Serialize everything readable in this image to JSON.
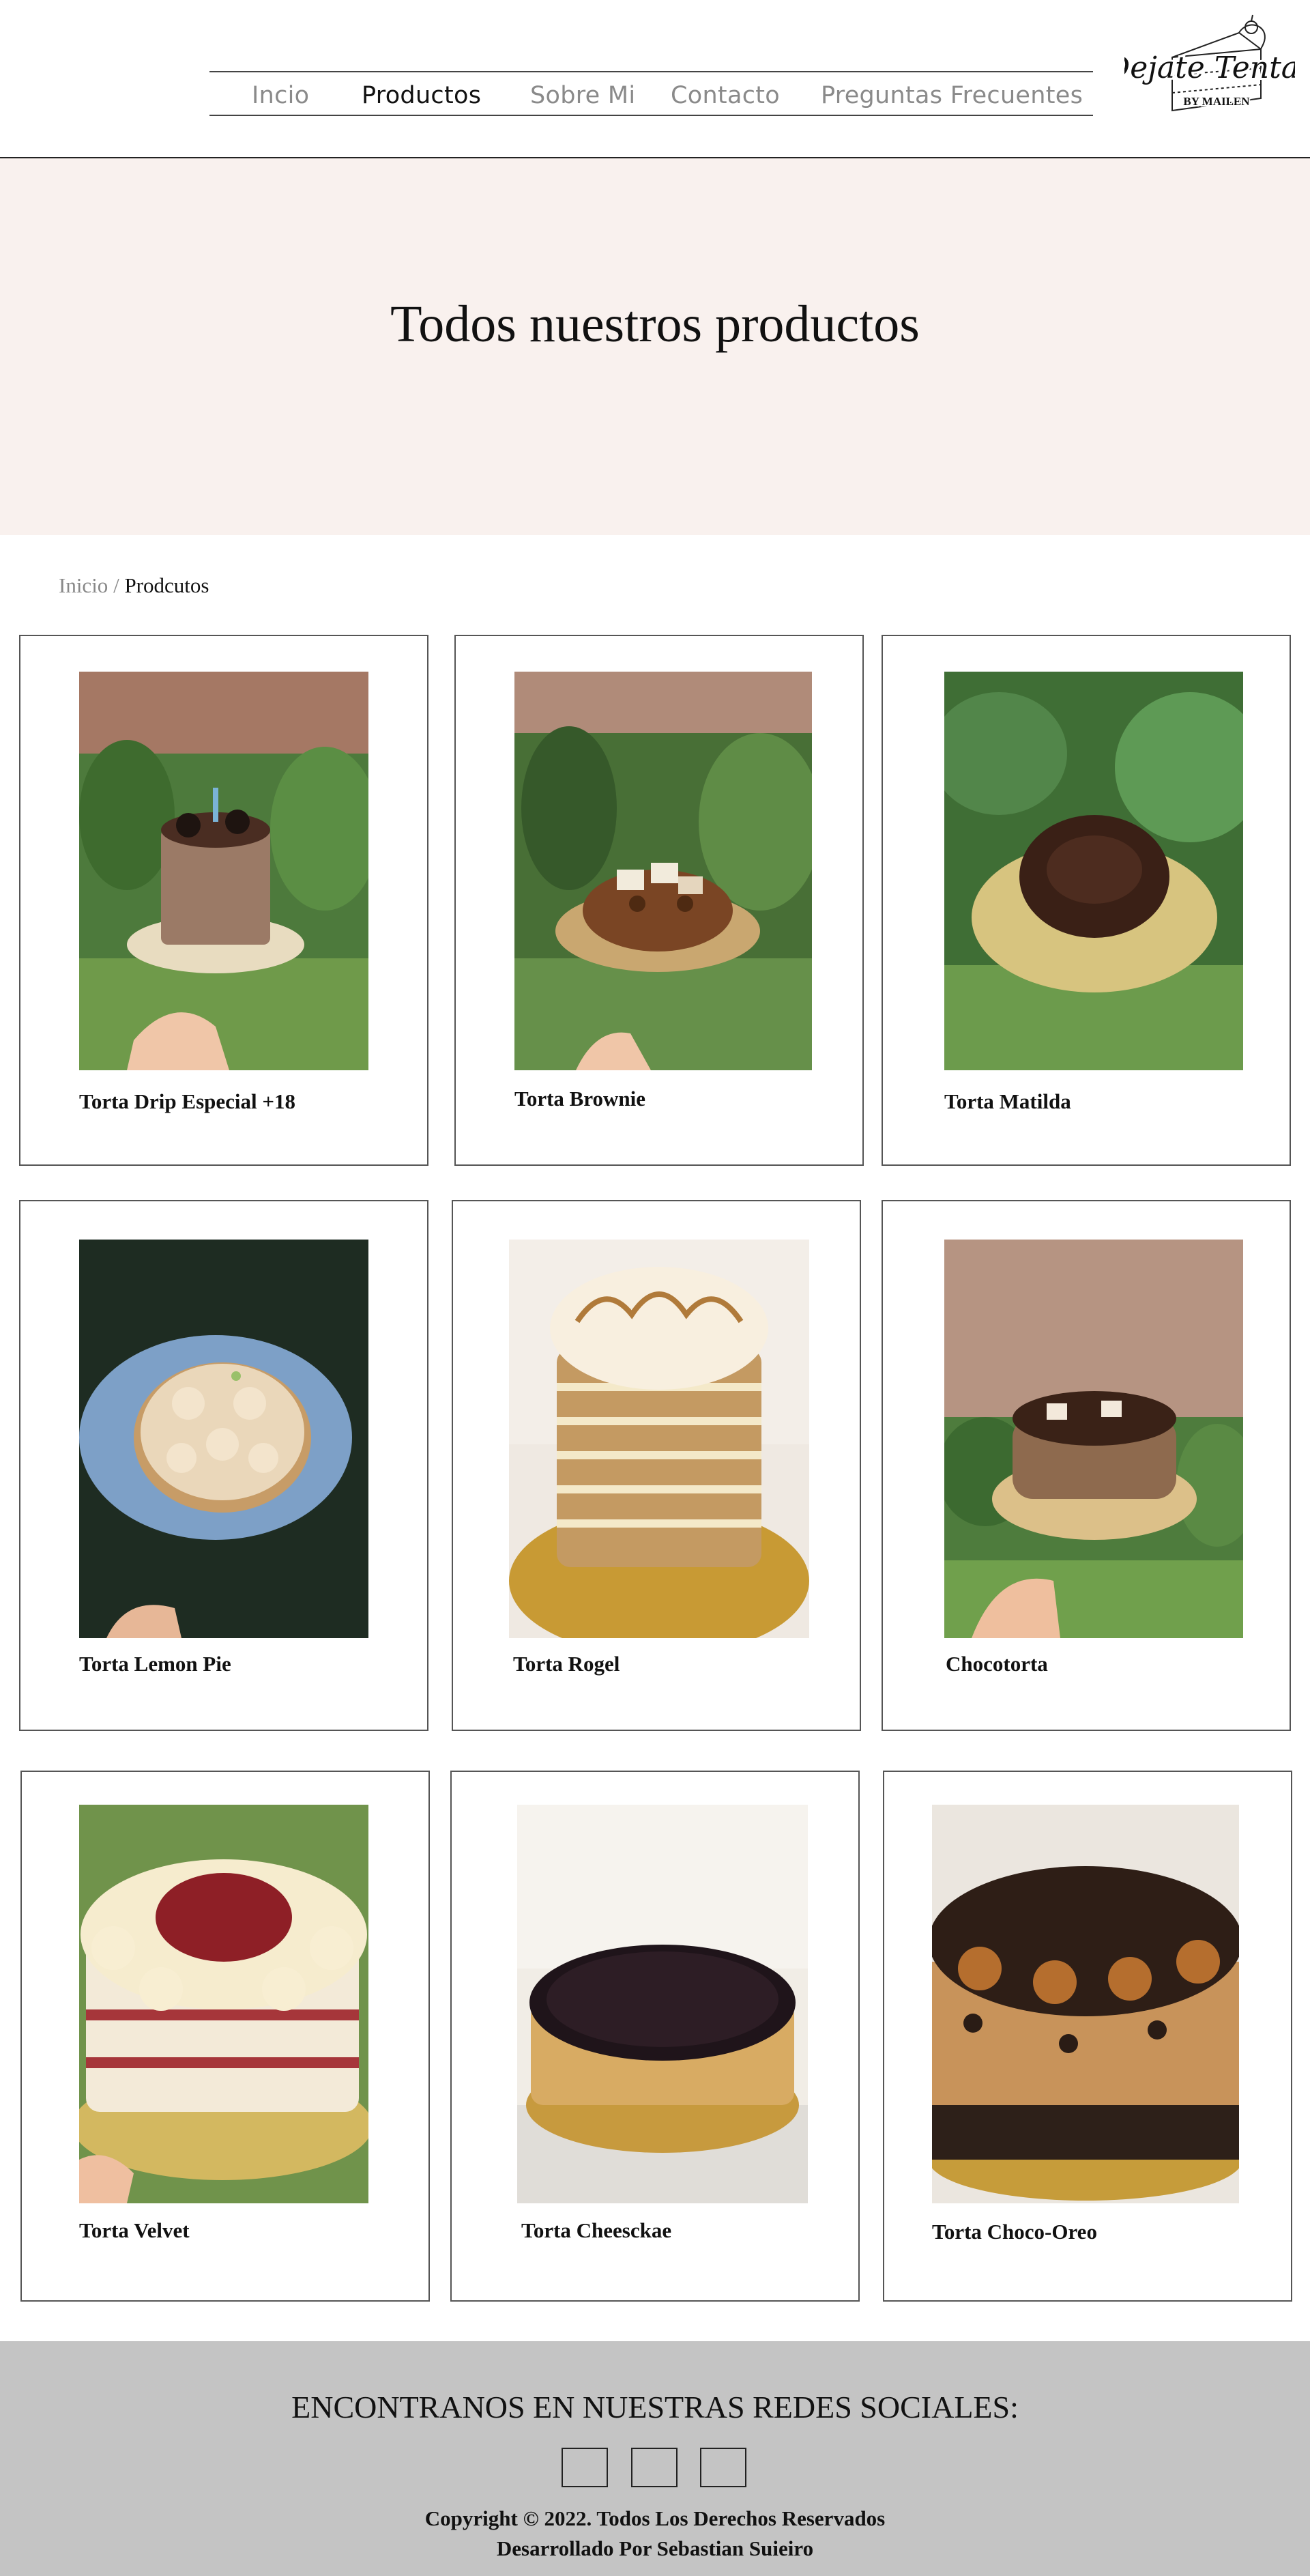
{
  "nav": {
    "items": [
      {
        "label": "Incio",
        "active": false
      },
      {
        "label": "Productos",
        "active": true
      },
      {
        "label": "Sobre Mi",
        "active": false
      },
      {
        "label": "Contacto",
        "active": false
      },
      {
        "label": "Preguntas Frecuentes",
        "active": false
      }
    ]
  },
  "logo": {
    "title": "Dejate Tentar",
    "subtitle": "BY MAILEN",
    "icon": "cake-slice-icon"
  },
  "hero": {
    "title": "Todos nuestros productos"
  },
  "breadcrumb": {
    "home": "Inicio",
    "separator": " / ",
    "current": "Prodcutos"
  },
  "products": [
    {
      "name": "Torta Drip Especial +18"
    },
    {
      "name": "Torta Brownie"
    },
    {
      "name": "Torta Matilda"
    },
    {
      "name": "Torta Lemon Pie"
    },
    {
      "name": "Torta Rogel"
    },
    {
      "name": "Chocotorta"
    },
    {
      "name": "Torta Velvet"
    },
    {
      "name": "Torta Cheesckae"
    },
    {
      "name": "Torta Choco-Oreo"
    }
  ],
  "footer": {
    "heading": "ENCONTRANOS EN NUESTRAS REDES SOCIALES:",
    "social_icons": [
      "social-icon",
      "social-icon",
      "social-icon"
    ],
    "copyright": "Copyright © 2022. Todos Los Derechos Reservados",
    "credit": "Desarrollado Por Sebastian Suieiro"
  },
  "colors": {
    "hero_bg": "#f9f1ee",
    "footer_bg": "#c4c4c4",
    "nav_inactive": "#8a8a8a",
    "nav_active": "#111111"
  }
}
